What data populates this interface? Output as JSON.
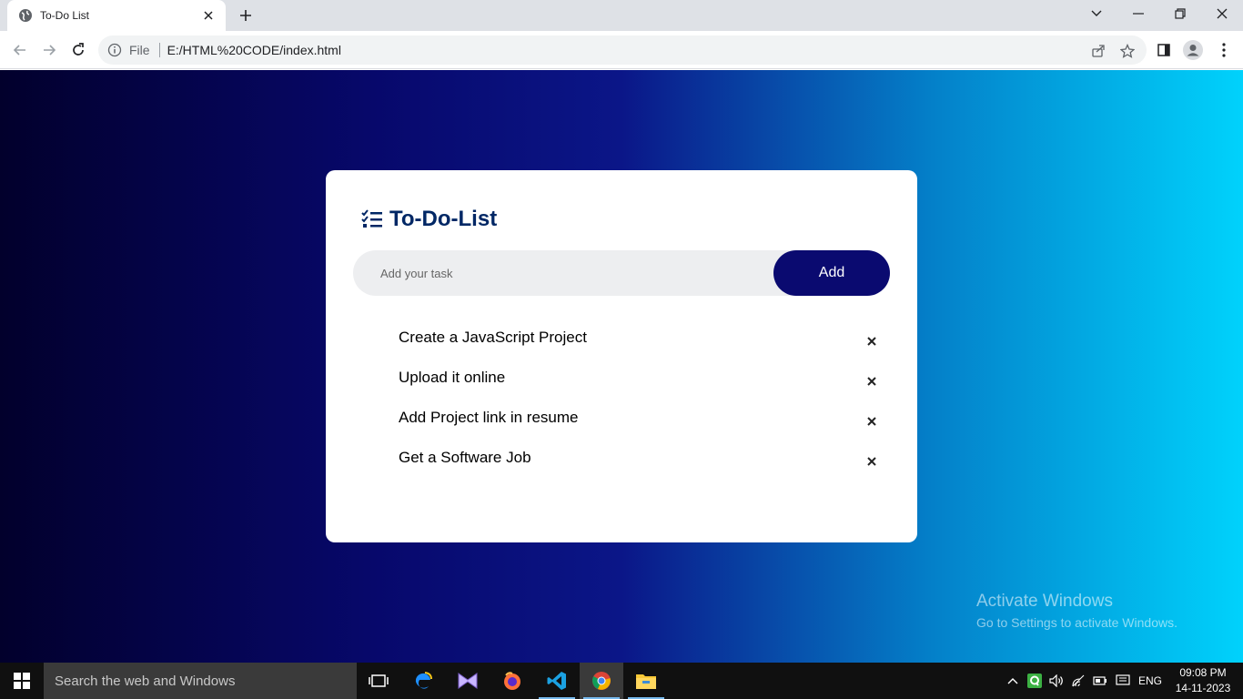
{
  "browser": {
    "tab_title": "To-Do List",
    "omnibox_scheme_label": "File",
    "url": "E:/HTML%20CODE/index.html"
  },
  "app": {
    "title": "To-Do-List",
    "input_placeholder": "Add your task",
    "add_label": "Add",
    "tasks": [
      {
        "text": "Create a JavaScript Project",
        "remove": "×"
      },
      {
        "text": "Upload it online",
        "remove": "×"
      },
      {
        "text": "Add Project link in resume",
        "remove": "×"
      },
      {
        "text": "Get a Software Job",
        "remove": "×"
      }
    ],
    "colors": {
      "title": "#002765",
      "button": "#0a0a70",
      "gradient_start": "#02002c",
      "gradient_end": "#00d2fc"
    }
  },
  "watermark": {
    "title": "Activate Windows",
    "subtitle": "Go to Settings to activate Windows."
  },
  "taskbar": {
    "search_placeholder": "Search the web and Windows",
    "language": "ENG",
    "time": "09:08 PM",
    "date": "14-11-2023"
  }
}
